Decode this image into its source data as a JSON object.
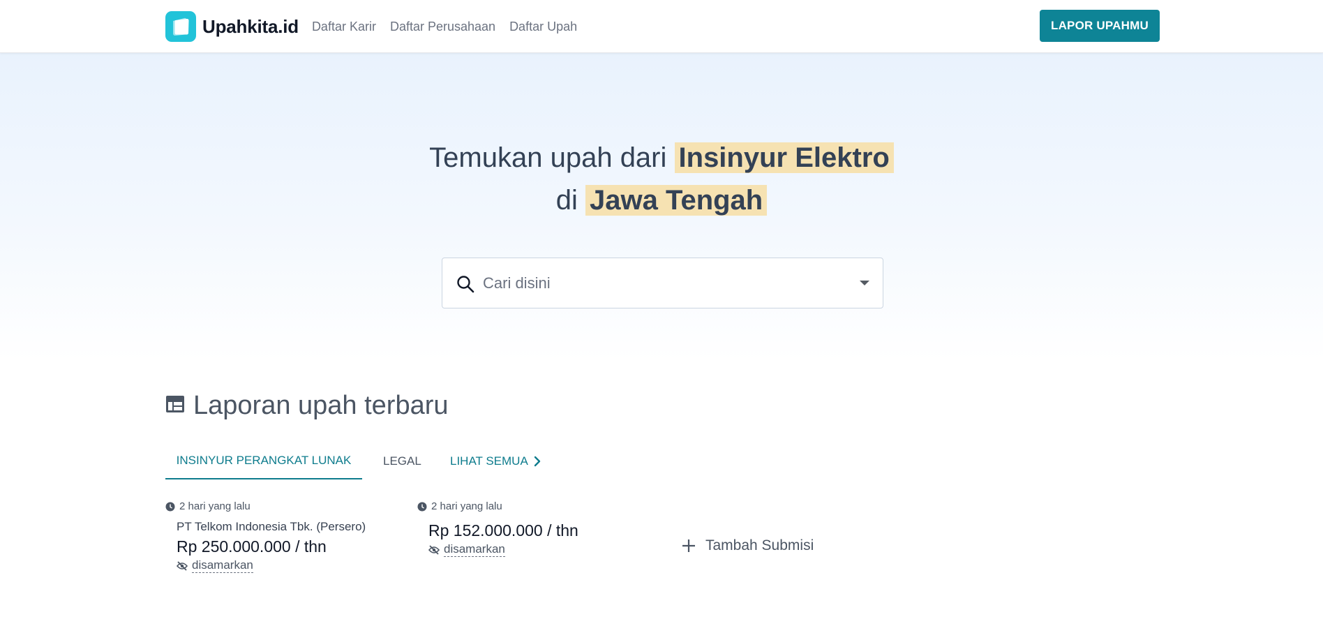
{
  "brand": {
    "name": "Upahkita.id",
    "accent": "#0e8496",
    "logo_color": "#22c3d9",
    "highlight": "#f6e2b2"
  },
  "nav": {
    "links": [
      "Daftar Karir",
      "Daftar Perusahaan",
      "Daftar Upah"
    ],
    "cta_label": "LAPOR UPAHMU"
  },
  "hero": {
    "line1_prefix": "Temukan upah dari",
    "job": "Insinyur Elektro",
    "line2_prefix": "di",
    "location": "Jawa Tengah"
  },
  "search": {
    "placeholder": "Cari disini",
    "icon": "search-icon",
    "dropdown_icon": "caret-down-icon"
  },
  "reports": {
    "title": "Laporan upah terbaru",
    "title_icon": "table-icon",
    "tabs": [
      {
        "label": "INSINYUR PERANGKAT LUNAK",
        "active": true
      },
      {
        "label": "LEGAL",
        "active": false
      }
    ],
    "see_all_label": "LIHAT SEMUA",
    "cards": [
      {
        "time": "2 hari yang lalu",
        "company": "PT Telkom Indonesia Tbk. (Persero)",
        "salary": "Rp 250.000.000 / thn",
        "anon_label": "disamarkan"
      },
      {
        "time": "2 hari yang lalu",
        "salary": "Rp 152.000.000 / thn",
        "anon_label": "disamarkan"
      }
    ],
    "add_label": "Tambah Submisi"
  }
}
